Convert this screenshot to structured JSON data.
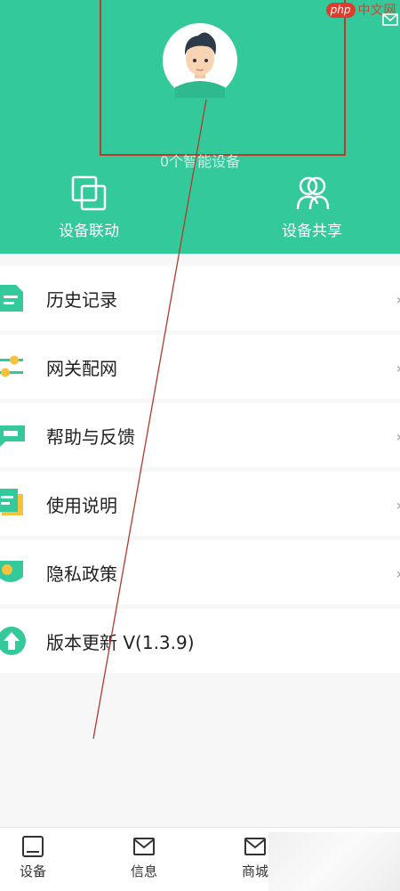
{
  "watermark": {
    "logo": "php",
    "text": "中文网"
  },
  "profile": {
    "device_count": "0个智能设备"
  },
  "quick_actions": [
    {
      "label": "设备联动",
      "icon": "squares-icon"
    },
    {
      "label": "设备共享",
      "icon": "share-users-icon"
    }
  ],
  "menu": [
    {
      "label": "历史记录",
      "icon": "document-icon",
      "color": "#34c99b"
    },
    {
      "label": "网关配网",
      "icon": "sliders-icon",
      "color": "#34c99b"
    },
    {
      "label": "帮助与反馈",
      "icon": "chat-icon",
      "color": "#34c99b"
    },
    {
      "label": "使用说明",
      "icon": "manual-icon",
      "color": "#34c99b"
    },
    {
      "label": "隐私政策",
      "icon": "shield-icon",
      "color": "#34c99b"
    },
    {
      "label": "版本更新 V(1.3.9)",
      "icon": "upgrade-icon",
      "color": "#34c99b"
    }
  ],
  "tabs": [
    {
      "label": "设备",
      "icon": "device-icon"
    },
    {
      "label": "信息",
      "icon": "mail-icon"
    },
    {
      "label": "商城",
      "icon": "shop-icon"
    }
  ],
  "colors": {
    "primary": "#34c99b",
    "annotation": "#c0392b",
    "accent_yellow": "#f6c23e"
  }
}
